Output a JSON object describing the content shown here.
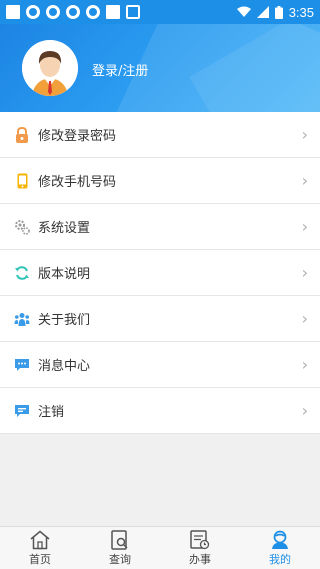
{
  "status_bar": {
    "time": "3:35"
  },
  "profile": {
    "login_label": "登录/注册"
  },
  "menu": [
    {
      "label": "修改登录密码",
      "icon": "lock-icon"
    },
    {
      "label": "修改手机号码",
      "icon": "phone-icon"
    },
    {
      "label": "系统设置",
      "icon": "gear-icon"
    },
    {
      "label": "版本说明",
      "icon": "refresh-icon"
    },
    {
      "label": "关于我们",
      "icon": "group-icon"
    },
    {
      "label": "消息中心",
      "icon": "message-icon"
    },
    {
      "label": "注销",
      "icon": "chat-icon"
    }
  ],
  "tabbar": [
    {
      "label": "首页",
      "icon": "home-icon"
    },
    {
      "label": "查询",
      "icon": "search-doc-icon"
    },
    {
      "label": "办事",
      "icon": "task-icon"
    },
    {
      "label": "我的",
      "icon": "user-icon",
      "active": true
    }
  ],
  "colors": {
    "primary": "#1e8fe6",
    "lock": "#f29a4c",
    "phone": "#f5b400",
    "gear": "#9a9a9a",
    "accent": "#30c4b8"
  }
}
